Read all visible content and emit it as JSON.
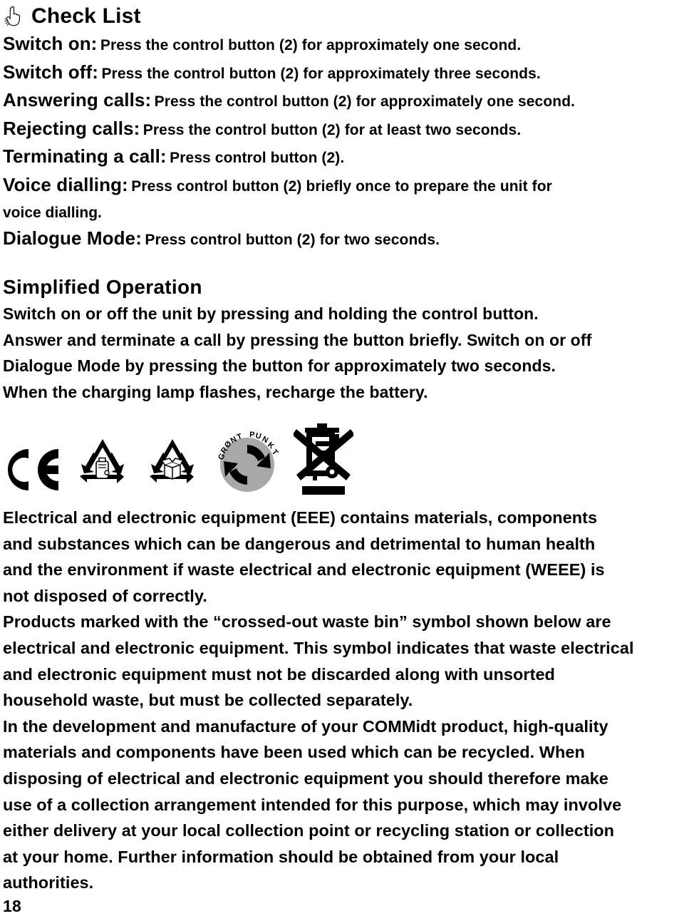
{
  "page": {
    "number": "18"
  },
  "checklist_section": {
    "icon": "pointing-hand-icon",
    "title": "Check List",
    "items": [
      {
        "term": "Switch on:",
        "desc": "Press the control button (2) for approximately one second."
      },
      {
        "term": "Switch off:",
        "desc": "Press the control button (2) for approximately three seconds."
      },
      {
        "term": "Answering calls:",
        "desc": "Press the control button (2) for approximately one second."
      },
      {
        "term": "Rejecting calls:",
        "desc": "Press the control button (2) for at least two seconds."
      },
      {
        "term": "Terminating a call:",
        "desc": "Press control button (2)."
      },
      {
        "term": "Voice dialling:",
        "desc": "Press control button (2) briefly once to prepare the unit for",
        "cont": "voice dialling."
      },
      {
        "term": "Dialogue Mode:",
        "desc": "Press control button (2) for two seconds."
      }
    ]
  },
  "simplified_operation": {
    "title": "Simplified Operation",
    "lines": [
      "Switch on or off the unit by pressing and holding the control button.",
      "Answer and terminate a call by pressing the button briefly. Switch on or off",
      "Dialogue Mode by pressing the button for approximately two seconds.",
      "When the charging lamp flashes, recharge the battery."
    ]
  },
  "symbols": [
    {
      "name": "ce-mark-icon",
      "label": "CE"
    },
    {
      "name": "recycling-battery-icon",
      "label": "Recycling triangle with battery"
    },
    {
      "name": "recycling-cardboard-icon",
      "label": "Recycling triangle with box"
    },
    {
      "name": "gront-punkt-icon",
      "label": "GRØNT PUNKT"
    },
    {
      "name": "crossed-out-waste-bin-icon",
      "label": "Crossed-out waste bin"
    }
  ],
  "weee_text": {
    "lines": [
      "Electrical and electronic equipment (EEE) contains materials, components",
      "and substances which can be dangerous and detrimental to human health",
      "and the environment if waste electrical and electronic equipment (WEEE) is",
      "not disposed of correctly.",
      "Products marked with the “crossed-out waste bin” symbol shown below are",
      "electrical and electronic equipment. This symbol indicates that waste electrical",
      "and electronic equipment must not be discarded along with unsorted",
      "household waste, but must be collected separately.",
      "In the development and manufacture of your COMMidt product, high-quality",
      "materials and components have been used which can be recycled. When",
      "disposing of electrical and electronic equipment you should therefore make",
      "use of a collection arrangement intended for this purpose, which may involve",
      "either delivery at your local collection point or recycling station or collection",
      "at your home. Further information should be obtained from your local",
      "authorities."
    ]
  },
  "colors": {
    "ink": "#000000",
    "paper": "#ffffff",
    "gront_punkt_disc": "#a8a8a8"
  }
}
